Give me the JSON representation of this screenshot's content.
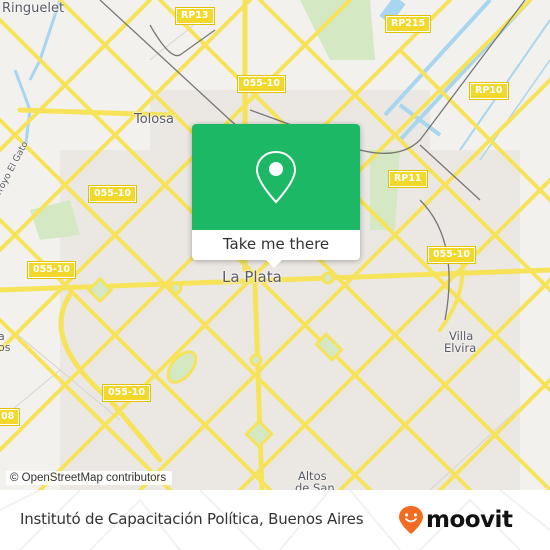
{
  "map": {
    "places": [
      {
        "name": "Ringuelet",
        "id": "ringuelet"
      },
      {
        "name": "Tolosa",
        "id": "tolosa"
      },
      {
        "name": "La Plata",
        "id": "la-plata"
      },
      {
        "name": "Villa",
        "id": "villa"
      },
      {
        "name": "Elvira",
        "id": "elvira"
      },
      {
        "name": "Altos",
        "id": "altos"
      },
      {
        "name": "de San",
        "id": "de-san"
      },
      {
        "name": "Arroyo El Gato",
        "id": "arroyo"
      },
      {
        "name": "a",
        "id": "edge-a"
      },
      {
        "name": "os",
        "id": "edge-os"
      }
    ],
    "shields": [
      "RP13",
      "RP215",
      "RP10",
      "055-10",
      "RP11",
      "055-10",
      "055-10",
      "055-10",
      "055-10",
      "08"
    ],
    "colors": {
      "land": "#f2f1ee",
      "urban": "#ebe7e3",
      "road": "#f7e35a",
      "water": "#a8d5ef",
      "park": "#d5e8c4",
      "popup_green": "#1db866"
    }
  },
  "popup": {
    "button_label": "Take me there",
    "icon": "location-pin-icon"
  },
  "attribution": "© OpenStreetMap contributors",
  "footer": {
    "title": "Institutó de Capacitación Política, Buenos Aires",
    "logo_text": "moovit",
    "logo_color": "#f26b21"
  }
}
